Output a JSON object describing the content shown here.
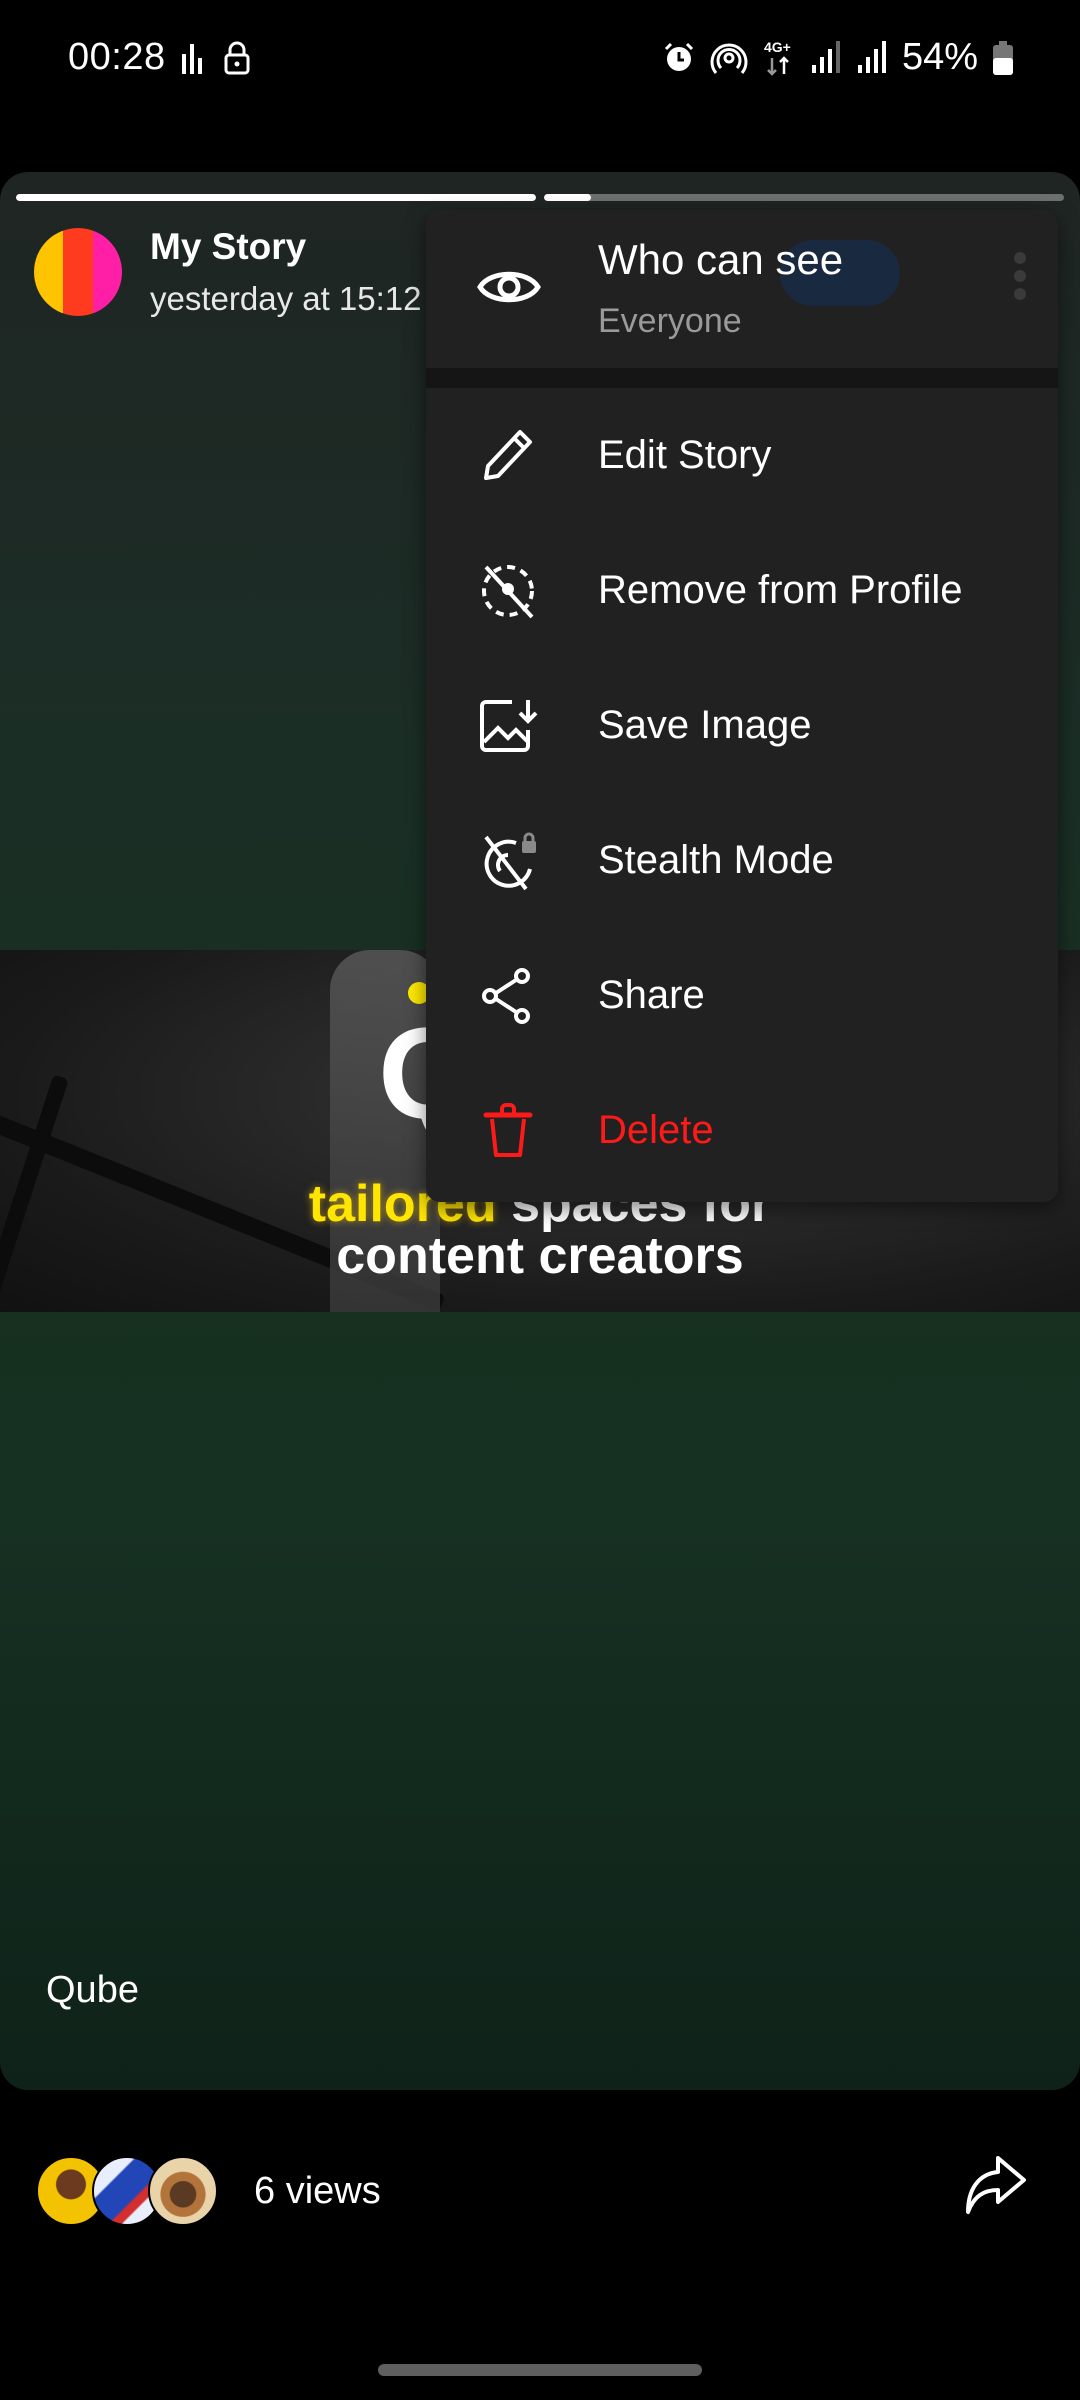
{
  "status_bar": {
    "time": "00:28",
    "battery": "54%",
    "network": "4G+",
    "icons": [
      "data-bars-icon",
      "lock-icon",
      "alarm-icon",
      "hotspot-icon",
      "4g-plus-icon",
      "signal-icon",
      "signal-icon",
      "battery-icon"
    ]
  },
  "story": {
    "title": "My Story",
    "timestamp": "yesterday at 15:12",
    "progress": [
      1.0,
      0.09
    ],
    "avatar_colors": [
      "#ffc400",
      "#ff3b1f",
      "#ff1fa6"
    ],
    "image": {
      "brand": "Qube",
      "tagline_highlight": "tailored",
      "tagline_rest_line1": " spaces for",
      "tagline_line2": "content creators",
      "highlight_color": "#ffe600"
    },
    "caption": "Qube"
  },
  "menu": {
    "who_can_see": {
      "label": "Who can see",
      "value": "Everyone",
      "icon": "eye-icon"
    },
    "items": [
      {
        "label": "Edit Story",
        "icon": "pencil-icon"
      },
      {
        "label": "Remove from Profile",
        "icon": "remove-from-profile-icon"
      },
      {
        "label": "Save Image",
        "icon": "save-image-icon"
      },
      {
        "label": "Stealth Mode",
        "icon": "stealth-mode-icon"
      },
      {
        "label": "Share",
        "icon": "share-icon"
      },
      {
        "label": "Delete",
        "icon": "trash-icon",
        "danger": true
      }
    ],
    "danger_color": "#ff1a1a"
  },
  "footer": {
    "views_label": "6 views",
    "viewer_count_shown": 3,
    "forward_icon": "forward-icon"
  }
}
